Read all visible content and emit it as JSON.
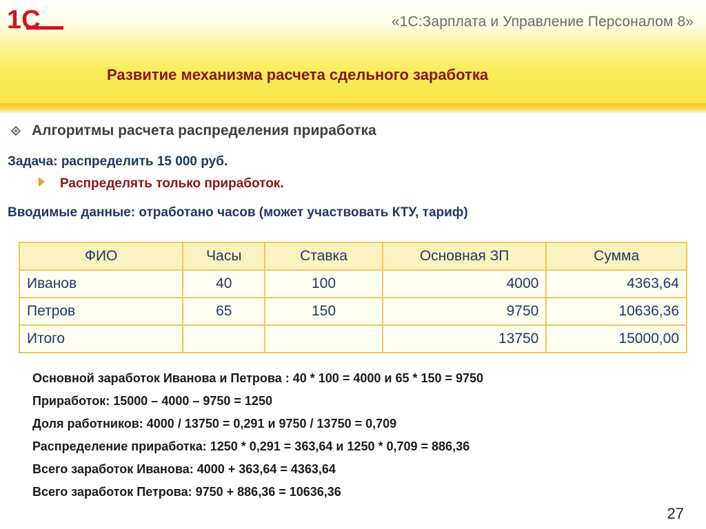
{
  "header": {
    "logo_text": "1С",
    "product_title": "«1С:Зарплата и Управление Персоналом 8»"
  },
  "slide": {
    "title": "Развитие механизма расчета сдельного заработка",
    "section_heading": "Алгоритмы расчета распределения приработка",
    "task": "Задача: распределить 15 000 руб.",
    "sub_bullet": "Распределять только приработок.",
    "input_data": "Вводимые данные: отработано часов (может участвовать КТУ, тариф)"
  },
  "table": {
    "headers": [
      "ФИО",
      "Часы",
      "Ставка",
      "Основная ЗП",
      "Сумма"
    ],
    "rows": [
      [
        "Иванов",
        "40",
        "100",
        "4000",
        "4363,64"
      ],
      [
        "Петров",
        "65",
        "150",
        "9750",
        "10636,36"
      ],
      [
        "Итого",
        "",
        "",
        "13750",
        "15000,00"
      ]
    ]
  },
  "calculations": [
    "Основной заработок Иванова и Петрова : 40 * 100 = 4000 и 65 * 150 = 9750",
    "Приработок: 15000 – 4000 – 9750 = 1250",
    "Доля работников: 4000 / 13750 = 0,291 и 9750 / 13750 = 0,709",
    "Распределение приработка: 1250 * 0,291 = 363,64 и 1250 * 0,709 = 886,36",
    "Всего заработок Иванова: 4000 + 363,64 = 4363,64",
    "Всего заработок Петрова: 9750 + 886,36 = 10636,36"
  ],
  "page_number": "27",
  "colors": {
    "title_red": "#8a1416",
    "text_blue": "#1f3864",
    "table_border": "#f0c85a",
    "band_yellow": "#f8ec5a",
    "logo_red": "#d7141a"
  }
}
